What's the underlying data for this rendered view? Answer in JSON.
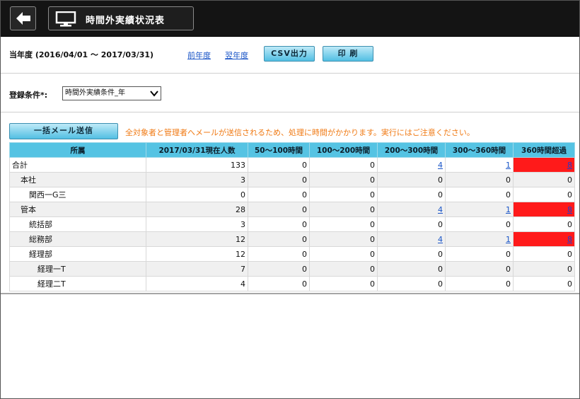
{
  "header": {
    "title": "時間外実績状況表",
    "back_icon": "arrow-left-icon",
    "screen_icon": "monitor-icon"
  },
  "toolbar": {
    "period": "当年度 (2016/04/01 ～ 2017/03/31)",
    "prev_year": "前年度",
    "next_year": "翌年度",
    "csv_button": "CSV出力",
    "print_button": "印 刷"
  },
  "conditions": {
    "label": "登録条件*:",
    "selected": "時間外実績条件_年"
  },
  "mail": {
    "button": "一括メール送信",
    "notice": "全対象者と管理者へメールが送信されるため、処理に時間がかかります。実行にはご注意ください。"
  },
  "table": {
    "headers": [
      "所属",
      "2017/03/31現在人数",
      "50～100時間",
      "100～200時間",
      "200～300時間",
      "300～360時間",
      "360時間超過"
    ],
    "rows": [
      {
        "name": "合計",
        "indent": 0,
        "count": "133",
        "c1": "0",
        "c2": "0",
        "c3": "4",
        "c4": "1",
        "c5": "8",
        "links": [
          3,
          4,
          5
        ],
        "red": true
      },
      {
        "name": "本社",
        "indent": 1,
        "count": "3",
        "c1": "0",
        "c2": "0",
        "c3": "0",
        "c4": "0",
        "c5": "0",
        "links": [],
        "red": false
      },
      {
        "name": "関西一G三",
        "indent": 2,
        "count": "0",
        "c1": "0",
        "c2": "0",
        "c3": "0",
        "c4": "0",
        "c5": "0",
        "links": [],
        "red": false
      },
      {
        "name": "管本",
        "indent": 1,
        "count": "28",
        "c1": "0",
        "c2": "0",
        "c3": "4",
        "c4": "1",
        "c5": "8",
        "links": [
          3,
          4,
          5
        ],
        "red": true
      },
      {
        "name": "統括部",
        "indent": 2,
        "count": "3",
        "c1": "0",
        "c2": "0",
        "c3": "0",
        "c4": "0",
        "c5": "0",
        "links": [],
        "red": false
      },
      {
        "name": "総務部",
        "indent": 2,
        "count": "12",
        "c1": "0",
        "c2": "0",
        "c3": "4",
        "c4": "1",
        "c5": "8",
        "links": [
          3,
          4,
          5
        ],
        "red": true
      },
      {
        "name": "経理部",
        "indent": 2,
        "count": "12",
        "c1": "0",
        "c2": "0",
        "c3": "0",
        "c4": "0",
        "c5": "0",
        "links": [],
        "red": false
      },
      {
        "name": "経理一T",
        "indent": 3,
        "count": "7",
        "c1": "0",
        "c2": "0",
        "c3": "0",
        "c4": "0",
        "c5": "0",
        "links": [],
        "red": false
      },
      {
        "name": "経理二T",
        "indent": 3,
        "count": "4",
        "c1": "0",
        "c2": "0",
        "c3": "0",
        "c4": "0",
        "c5": "0",
        "links": [],
        "red": false
      }
    ]
  },
  "colors": {
    "header_bg": "#141414",
    "table_header": "#55c3e3",
    "alert": "#ff1a1a",
    "notice": "#f07a14",
    "link": "#1a55c7"
  }
}
